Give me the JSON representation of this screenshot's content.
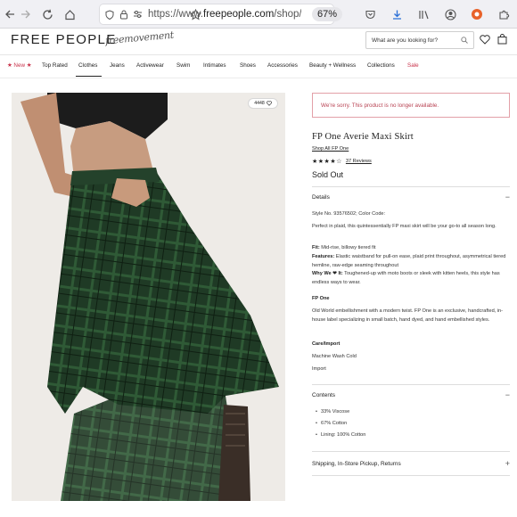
{
  "browser": {
    "url_prefix": "https://www.",
    "url_domain": "freepeople.com",
    "url_path": "/shop/fp",
    "zoom": "67%"
  },
  "header": {
    "logo": "FREE PEOPLE",
    "logo_script": "freemovement",
    "search_placeholder": "What are you looking for?"
  },
  "nav": {
    "items": [
      "★ New ★",
      "Top Rated",
      "Clothes",
      "Jeans",
      "Activewear",
      "Swim",
      "Intimates",
      "Shoes",
      "Accessories",
      "Beauty + Wellness",
      "Collections",
      "Sale"
    ]
  },
  "product": {
    "like_count": "4448",
    "alert": "We're sorry. This product is no longer available.",
    "title": "FP One Averie Maxi Skirt",
    "brand_link": "Shop All FP One",
    "stars": "★★★★☆",
    "reviews": "37 Reviews",
    "status": "Sold Out"
  },
  "details": {
    "heading": "Details",
    "style_no": "Style No. 93576502; Color Code:",
    "intro": "Perfect in plaid, this quintessentially FP maxi skirt will be your go-to all season long.",
    "fit_label": "Fit:",
    "fit": " Mid-rise, billowy tiered fit",
    "features_label": "Features:",
    "features": " Elastic waistband for pull-on ease, plaid print throughout, asymmetrical tiered hemline, raw-edge seaming throughout",
    "why_label": "Why We ❤ It:",
    "why": " Toughened-up with moto boots or sleek with kitten heels, this style has endless ways to wear.",
    "fpone_heading": "FP One",
    "fpone_text": "Old World embellishment with a modern twist. FP One is an exclusive, handcrafted, in-house label specializing in small batch, hand dyed, and hand embellished styles.",
    "care_heading": "Care/Import",
    "care": "Machine Wash Cold",
    "import": "Import"
  },
  "contents": {
    "heading": "Contents",
    "items": [
      "33% Viscose",
      "67% Cotton",
      "Lining: 100% Cotton"
    ]
  },
  "shipping": {
    "heading": "Shipping, In-Store Pickup, Returns"
  },
  "icons": {
    "minus": "−",
    "plus": "+"
  }
}
